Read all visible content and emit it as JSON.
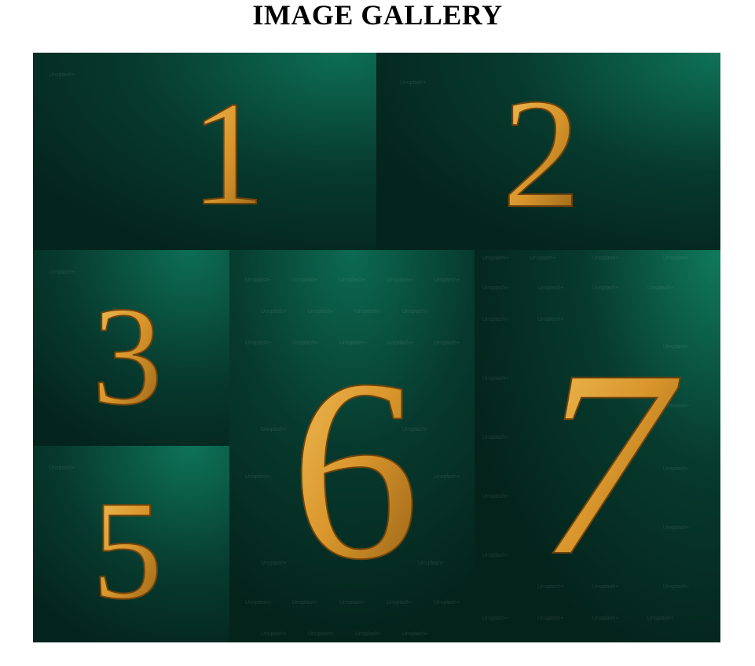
{
  "page": {
    "title": "IMAGE GALLERY"
  },
  "gallery": {
    "images": [
      {
        "digit": "1",
        "watermark": "Unsplash+"
      },
      {
        "digit": "2",
        "watermark": "Unsplash+"
      },
      {
        "digit": "3",
        "watermark": "Unsplash+"
      },
      {
        "digit": "5",
        "watermark": "Unsplash+"
      },
      {
        "digit": "6",
        "watermark": "Unsplash+"
      },
      {
        "digit": "7",
        "watermark": "Unsplash+"
      }
    ]
  },
  "colors": {
    "background_dark": "#062b22",
    "background_light": "#0b6b52",
    "digit_gold": "#e0a13a",
    "digit_gold_dark": "#8a5a12"
  }
}
